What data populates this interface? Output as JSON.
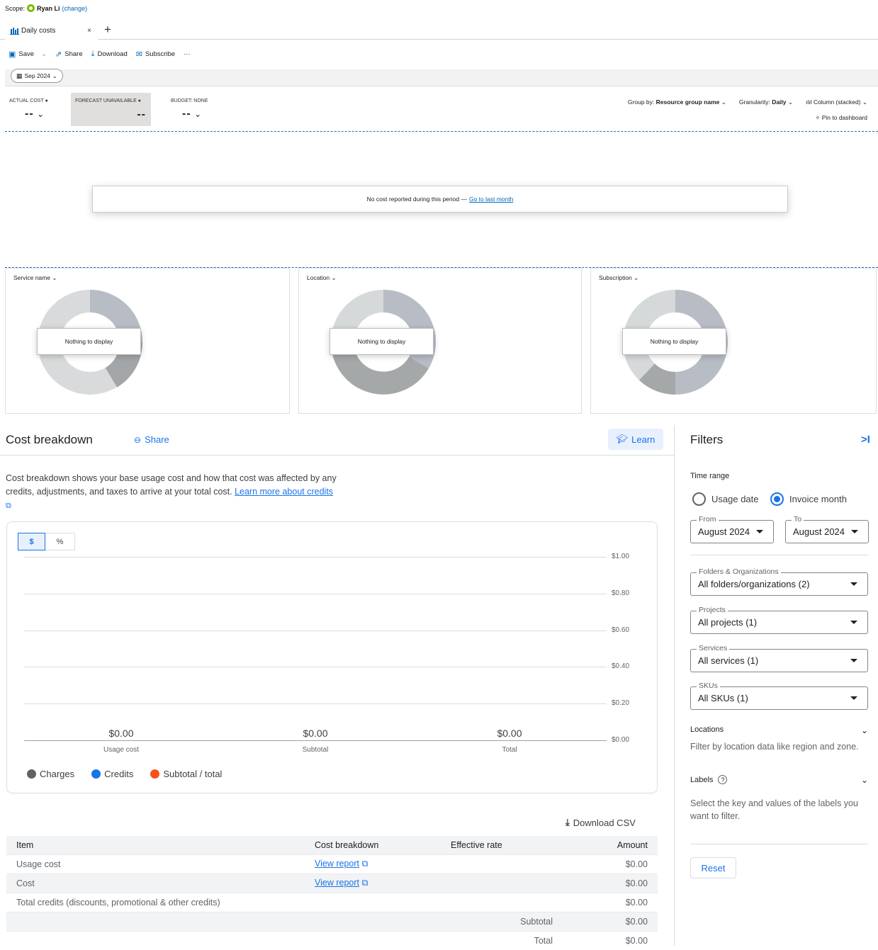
{
  "scope": {
    "label": "Scope:",
    "name": "Ryan Li",
    "change": "(change)"
  },
  "tab": {
    "label": "Daily costs",
    "close": "×",
    "add": "+"
  },
  "toolbar": {
    "save": "Save",
    "share": "Share",
    "download": "Download",
    "subscribe": "Subscribe",
    "more": "···"
  },
  "date_pill": "Sep 2024",
  "kpis": {
    "actual_label": "ACTUAL COST",
    "actual_value": "--",
    "forecast_label": "FORECAST UNAVAILABLE",
    "forecast_value": "--",
    "budget_label": "BUDGET: NONE",
    "budget_value": "--"
  },
  "controls": {
    "group_by_label": "Group by:",
    "group_by_value": "Resource group name",
    "granularity_label": "Granularity:",
    "granularity_value": "Daily",
    "chart_type": "Column (stacked)",
    "pin": "Pin to dashboard"
  },
  "no_cost": {
    "text": "No cost reported during this period —",
    "link": "Go to last month"
  },
  "panels": [
    {
      "title": "Service name",
      "empty": "Nothing to display"
    },
    {
      "title": "Location",
      "empty": "Nothing to display"
    },
    {
      "title": "Subscription",
      "empty": "Nothing to display"
    }
  ],
  "cost_breakdown": {
    "title": "Cost breakdown",
    "share": "Share",
    "learn": "Learn",
    "desc": "Cost breakdown shows your base usage cost and how that cost was affected by any credits, adjustments, and taxes to arrive at your total cost.",
    "desc_link": "Learn more about credits",
    "toggle_dollar": "$",
    "toggle_percent": "%",
    "download_csv": "Download CSV"
  },
  "chart_data": {
    "type": "bar",
    "categories": [
      "Usage cost",
      "Subtotal",
      "Total"
    ],
    "value_labels": [
      "$0.00",
      "$0.00",
      "$0.00"
    ],
    "series": [
      {
        "name": "Charges",
        "values": [
          0,
          0,
          0
        ]
      },
      {
        "name": "Credits",
        "values": [
          0,
          0,
          0
        ]
      },
      {
        "name": "Subtotal / total",
        "values": [
          0,
          0,
          0
        ]
      }
    ],
    "yticks": [
      "$1.00",
      "$0.80",
      "$0.60",
      "$0.40",
      "$0.20",
      "$0.00"
    ],
    "ylim": [
      0,
      1
    ],
    "colors": {
      "Charges": "#5f6368",
      "Credits": "#1a73e8",
      "Subtotal / total": "#f4511e"
    }
  },
  "table": {
    "headers": [
      "Item",
      "Cost breakdown",
      "Effective rate",
      "Amount"
    ],
    "rows": [
      {
        "item": "Usage cost",
        "link": "View report",
        "rate": "",
        "amount": "$0.00"
      },
      {
        "item": "Cost",
        "link": "View report",
        "rate": "",
        "amount": "$0.00"
      },
      {
        "item": "Total credits (discounts, promotional & other credits)",
        "link": "",
        "rate": "",
        "amount": "$0.00"
      },
      {
        "item": "",
        "link": "",
        "rate": "Subtotal",
        "amount": "$0.00"
      },
      {
        "item": "",
        "link": "",
        "rate": "Total",
        "amount": "$0.00"
      }
    ]
  },
  "filters": {
    "title": "Filters",
    "collapse": ">I",
    "time_range": "Time range",
    "usage_date": "Usage date",
    "invoice_month": "Invoice month",
    "from_label": "From",
    "from_value": "August 2024",
    "to_label": "To",
    "to_value": "August 2024",
    "folders_label": "Folders & Organizations",
    "folders_value": "All folders/organizations (2)",
    "projects_label": "Projects",
    "projects_value": "All projects (1)",
    "services_label": "Services",
    "services_value": "All services (1)",
    "skus_label": "SKUs",
    "skus_value": "All SKUs (1)",
    "locations_title": "Locations",
    "locations_desc": "Filter by location data like region and zone.",
    "labels_title": "Labels",
    "labels_desc": "Select the key and values of the labels you want to filter.",
    "reset": "Reset"
  }
}
